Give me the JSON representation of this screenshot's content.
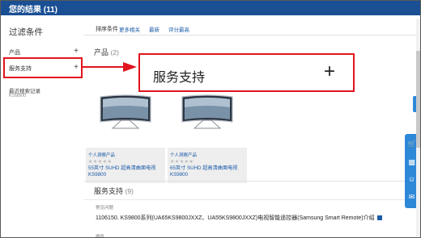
{
  "header": {
    "title": "您的结果 (11)"
  },
  "sidebar": {
    "filter_title": "过滤条件",
    "items": [
      {
        "label": "产品",
        "toggle": "+"
      },
      {
        "label": "服务支持",
        "toggle": "+"
      }
    ],
    "recent_search_label": "最近搜索记录",
    "recent_search_value": "KS9800"
  },
  "sortbar": {
    "label": "排序条件",
    "options": [
      "更多相关",
      "最新",
      "评分最高"
    ]
  },
  "products": {
    "title": "产品",
    "count": "(2)",
    "cards": [
      {
        "category": "个人洞察产品",
        "stars": "★★★★★",
        "name": "55英寸 SUHD 超高清曲面电视 KS9800"
      },
      {
        "category": "个人洞察产品",
        "stars": "★★★★★",
        "name": "65英寸 SUHD 超高清曲面电视 KS9800"
      }
    ]
  },
  "service": {
    "title": "服务支持",
    "count": "(9)",
    "faq_label": "常见问题",
    "faq_link": "1106150. KS9800系列(UA65KS9800JXXZ、UA55KS9800JXXZ)电视智能遥控器(Samsung Smart Remote)介绍",
    "plugin_label": "插件"
  },
  "callout": {
    "label": "服务支持",
    "toggle": "+"
  },
  "colors": {
    "header_bg": "#1a4f94",
    "link": "#1a5aa8",
    "highlight": "#e0141e",
    "side_button": "#2e88d8"
  },
  "icons": [
    "search-result-tv-image",
    "cart-icon",
    "gift-icon",
    "support-agent-icon",
    "chat-icon"
  ]
}
